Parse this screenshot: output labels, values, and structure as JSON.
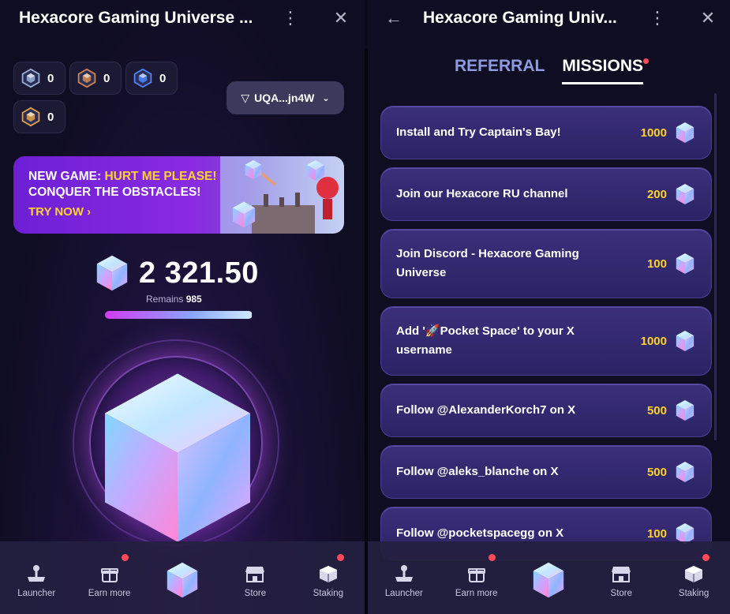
{
  "left": {
    "title": "Hexacore Gaming Universe ...",
    "gems": [
      {
        "icon": "gem-silver-icon",
        "count": "0"
      },
      {
        "icon": "gem-bronze-icon",
        "count": "0"
      },
      {
        "icon": "gem-blue-icon",
        "count": "0"
      },
      {
        "icon": "gem-gold-icon",
        "count": "0"
      }
    ],
    "wallet": "UQA...jn4W",
    "banner": {
      "line1_prefix": "NEW GAME: ",
      "line1_highlight": "HURT ME PLEASE!",
      "line2": "CONQUER THE OBSTACLES!",
      "cta": "TRY NOW"
    },
    "balance": "2 321.50",
    "remains_label": "Remains",
    "remains_value": "985",
    "energy_fraction": 0.995
  },
  "right": {
    "title": "Hexacore Gaming Univ...",
    "tabs": [
      {
        "label": "REFERRAL",
        "active": false
      },
      {
        "label": "MISSIONS",
        "active": true
      }
    ],
    "missions": [
      {
        "title": "Install and Try Captain's Bay!",
        "reward": "1000"
      },
      {
        "title": "Join our Hexacore RU channel",
        "reward": "200"
      },
      {
        "title": "Join Discord - Hexacore Gaming Universe",
        "reward": "100"
      },
      {
        "title": "Add '🚀Pocket Space' to your X username",
        "reward": "1000"
      },
      {
        "title": "Follow @AlexanderKorch7 on X",
        "reward": "500"
      },
      {
        "title": "Follow @aleks_blanche on X",
        "reward": "500"
      },
      {
        "title": "Follow @pocketspacegg on X",
        "reward": "100"
      }
    ]
  },
  "nav": {
    "items": [
      {
        "label": "Launcher",
        "icon": "joystick-icon"
      },
      {
        "label": "Earn more",
        "icon": "gift-icon",
        "badge": true
      },
      {
        "label": "",
        "icon": "hexacube-icon"
      },
      {
        "label": "Store",
        "icon": "store-icon"
      },
      {
        "label": "Staking",
        "icon": "boxes-icon",
        "badge": true
      }
    ]
  },
  "colors": {
    "accent_yellow": "#ffd22e",
    "badge_red": "#ff4a5a",
    "card": "#33287a"
  }
}
